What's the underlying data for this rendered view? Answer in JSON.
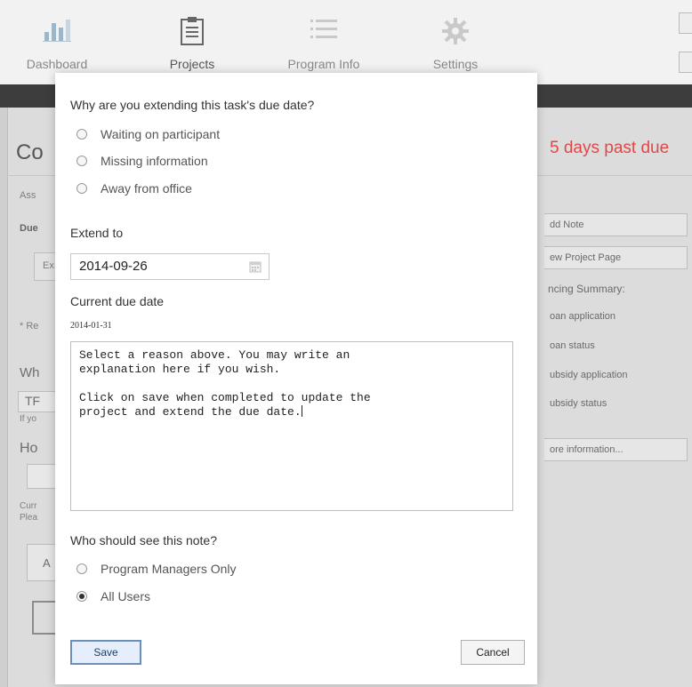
{
  "nav": {
    "items": [
      {
        "label": "Dashboard",
        "icon": "bar-chart-icon"
      },
      {
        "label": "Projects",
        "icon": "clipboard-icon"
      },
      {
        "label": "Program Info",
        "icon": "list-icon"
      },
      {
        "label": "Settings",
        "icon": "gear-icon"
      }
    ],
    "active": "Projects"
  },
  "background": {
    "title_fragment": "Co",
    "past_due_text": "5 days past due",
    "left_fragments": [
      "Ass",
      "Due",
      "Ex",
      "* Re",
      "Wh",
      "TF",
      "If yo",
      "Ho",
      "Curr",
      "Plea",
      "A"
    ],
    "side_buttons": [
      "dd Note",
      "ew Project Page"
    ],
    "side_heading": "ncing Summary:",
    "side_links": [
      "oan application",
      "oan status",
      "ubsidy application",
      "ubsidy status"
    ],
    "more_info_button": "ore information..."
  },
  "dialog": {
    "question_reason": "Why are you extending this task's due date?",
    "reasons": [
      {
        "label": "Waiting on participant",
        "checked": false
      },
      {
        "label": "Missing information",
        "checked": false
      },
      {
        "label": "Away from office",
        "checked": false
      }
    ],
    "extend_to_label": "Extend to",
    "extend_to_value": "2014-09-26",
    "current_due_label": "Current due date",
    "current_due_value": "2014-01-31",
    "note_text": "Select a reason above. You may write an\nexplanation here if you wish.\n\nClick on save when completed to update the\nproject and extend the due date.",
    "visibility_question": "Who should see this note?",
    "visibility_options": [
      {
        "label": "Program Managers Only",
        "checked": false
      },
      {
        "label": "All Users",
        "checked": true
      }
    ],
    "save_label": "Save",
    "cancel_label": "Cancel"
  },
  "colors": {
    "past_due": "#e04848",
    "save_border": "#6b8fb8",
    "save_fill": "#e5eefa",
    "dark_bar": "#3d3d3d"
  }
}
